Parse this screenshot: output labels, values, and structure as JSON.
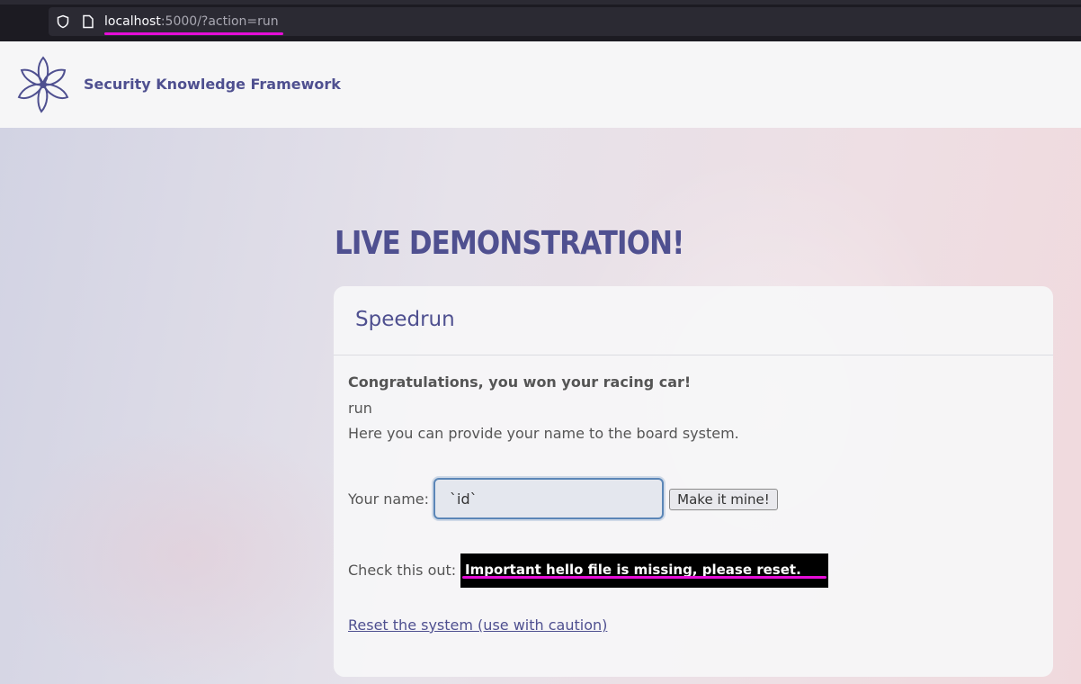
{
  "browser": {
    "url_host": "localhost",
    "url_rest": ":5000/?action=run"
  },
  "header": {
    "brand": "Security Knowledge Framework"
  },
  "main": {
    "title": "LIVE DEMONSTRATION!",
    "card": {
      "title": "Speedrun",
      "congrats": "Congratulations, you won your racing car!",
      "action": "run",
      "intro": "Here you can provide your name to the board system.",
      "name_label": "Your name:",
      "name_value": "`id`",
      "submit_label": "Make it mine!",
      "check_label": "Check this out:",
      "result": "Important hello file is missing, please reset.",
      "reset_link": "Reset the system (use with caution)"
    }
  },
  "colors": {
    "accent": "#4f5090",
    "highlight": "#e60ed8",
    "result_bg": "#000000"
  },
  "icons": [
    "shield-icon",
    "page-icon",
    "flower-logo-icon"
  ]
}
